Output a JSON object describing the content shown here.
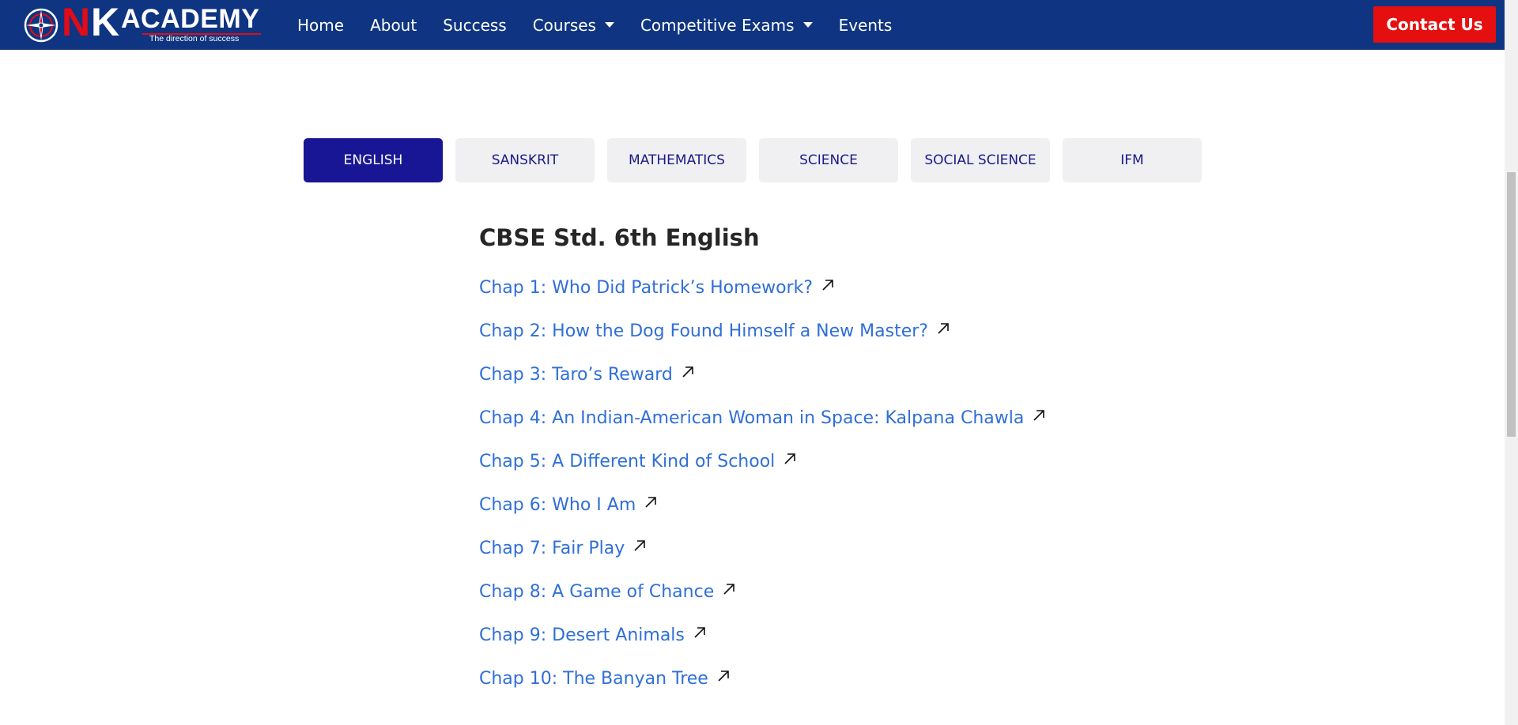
{
  "brand": {
    "logo_n": "N",
    "logo_k": "K",
    "logo_academy": "ACADEMY",
    "tagline": "The direction of success",
    "emblem_icon": "compass-emblem-icon"
  },
  "nav": {
    "items": [
      {
        "label": "Home",
        "dropdown": false
      },
      {
        "label": "About",
        "dropdown": false
      },
      {
        "label": "Success",
        "dropdown": false
      },
      {
        "label": "Courses",
        "dropdown": true
      },
      {
        "label": "Competitive Exams",
        "dropdown": true
      },
      {
        "label": "Events",
        "dropdown": false
      }
    ],
    "contact_label": "Contact Us"
  },
  "tabs": [
    {
      "label": "ENGLISH",
      "active": true
    },
    {
      "label": "SANSKRIT",
      "active": false
    },
    {
      "label": "MATHEMATICS",
      "active": false
    },
    {
      "label": "SCIENCE",
      "active": false
    },
    {
      "label": "SOCIAL SCIENCE",
      "active": false
    },
    {
      "label": "IFM",
      "active": false
    }
  ],
  "section": {
    "title": "CBSE Std. 6th English",
    "chapters": [
      "Chap 1: Who Did Patrick’s Homework?",
      "Chap 2: How the Dog Found Himself a New Master?",
      "Chap 3: Taro’s Reward",
      "Chap 4: An Indian-American Woman in Space: Kalpana Chawla",
      "Chap 5: A Different Kind of School",
      "Chap 6: Who I Am",
      "Chap 7: Fair Play",
      "Chap 8: A Game of Chance",
      "Chap 9: Desert Animals",
      "Chap 10: The Banyan Tree"
    ],
    "link_icon": "arrow-up-right-icon"
  },
  "colors": {
    "navbar": "#0f3582",
    "contact_button": "#e60f0f",
    "tab_active": "#181694",
    "tab_inactive": "#f0f0f2",
    "link": "#2f6fd7",
    "logo_red": "#e30b17"
  }
}
